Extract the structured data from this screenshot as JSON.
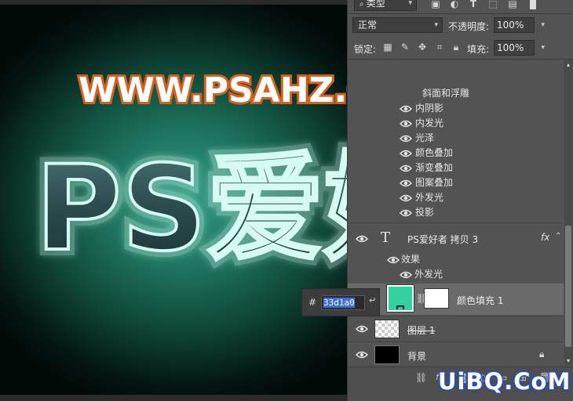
{
  "canvas": {
    "top_text": "WWW.PSAHZ.COM",
    "art_text": "PS爱好"
  },
  "toolbar": {
    "filter_kind": "类型",
    "blend_mode": "正常",
    "opacity_label": "不透明度:",
    "opacity_value": "100%",
    "lock_label": "锁定:",
    "fill_label": "填充:",
    "fill_value": "100%"
  },
  "effects_upper": {
    "partial_top": "斜面和浮雕",
    "items": [
      "内阴影",
      "内发光",
      "光泽",
      "颜色叠加",
      "渐变叠加",
      "图案叠加",
      "外发光",
      "投影"
    ]
  },
  "layers": [
    {
      "name": "PS爱好者 拷贝 3",
      "type": "text",
      "fx": "fx"
    },
    {
      "name": "颜色填充 1",
      "type": "fill",
      "swatch": "#33d1a0"
    },
    {
      "name": "图层 1",
      "type": "raster"
    },
    {
      "name": "背景",
      "type": "background"
    }
  ],
  "layer_effects": {
    "header": "效果",
    "items": [
      "外发光"
    ]
  },
  "color_popup": {
    "hash": "#",
    "hex_value": "33d1a0"
  },
  "watermark": "UiBQ.CoM",
  "colors": {
    "accent_fill": "#33d1a0",
    "panel_bg": "#535353",
    "selected_row": "#6a6a6a"
  }
}
